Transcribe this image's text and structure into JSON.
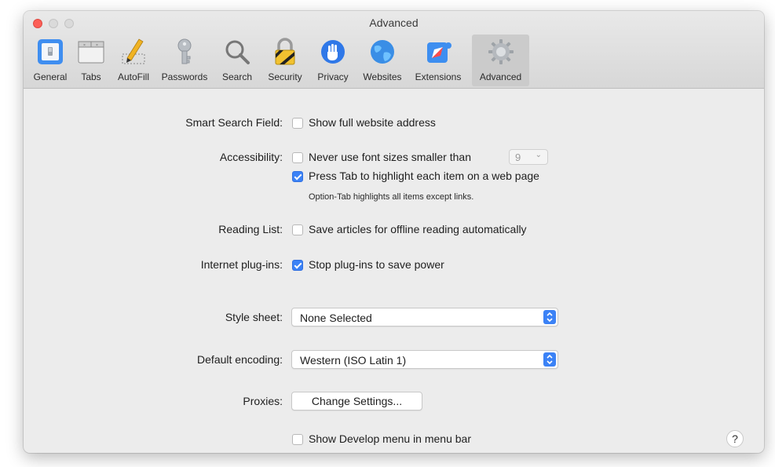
{
  "window": {
    "title": "Advanced"
  },
  "toolbar": {
    "items": [
      {
        "label": "General",
        "icon": "general-switch-icon"
      },
      {
        "label": "Tabs",
        "icon": "tabs-icon"
      },
      {
        "label": "AutoFill",
        "icon": "autofill-pencil-icon"
      },
      {
        "label": "Passwords",
        "icon": "key-icon"
      },
      {
        "label": "Search",
        "icon": "magnifier-icon"
      },
      {
        "label": "Security",
        "icon": "padlock-icon"
      },
      {
        "label": "Privacy",
        "icon": "hand-icon"
      },
      {
        "label": "Websites",
        "icon": "globe-icon"
      },
      {
        "label": "Extensions",
        "icon": "extensions-icon"
      },
      {
        "label": "Advanced",
        "icon": "gear-icon",
        "selected": true
      }
    ]
  },
  "settings": {
    "smart_search": {
      "label": "Smart Search Field:",
      "option": "Show full website address",
      "checked": false
    },
    "accessibility": {
      "label": "Accessibility:",
      "font_option": "Never use font sizes smaller than",
      "font_checked": false,
      "font_size": "9",
      "tab_option": "Press Tab to highlight each item on a web page",
      "tab_checked": true,
      "note": "Option-Tab highlights all items except links."
    },
    "reading_list": {
      "label": "Reading List:",
      "option": "Save articles for offline reading automatically",
      "checked": false
    },
    "plugins": {
      "label": "Internet plug-ins:",
      "option": "Stop plug-ins to save power",
      "checked": true
    },
    "style_sheet": {
      "label": "Style sheet:",
      "value": "None Selected"
    },
    "encoding": {
      "label": "Default encoding:",
      "value": "Western (ISO Latin 1)"
    },
    "proxies": {
      "label": "Proxies:",
      "button": "Change Settings..."
    },
    "develop": {
      "option": "Show Develop menu in menu bar",
      "checked": false
    }
  },
  "help": {
    "label": "?"
  },
  "colors": {
    "accent": "#3b82f6",
    "window_bg": "#ececec",
    "toolbar_selected": "#cbcbcb"
  }
}
